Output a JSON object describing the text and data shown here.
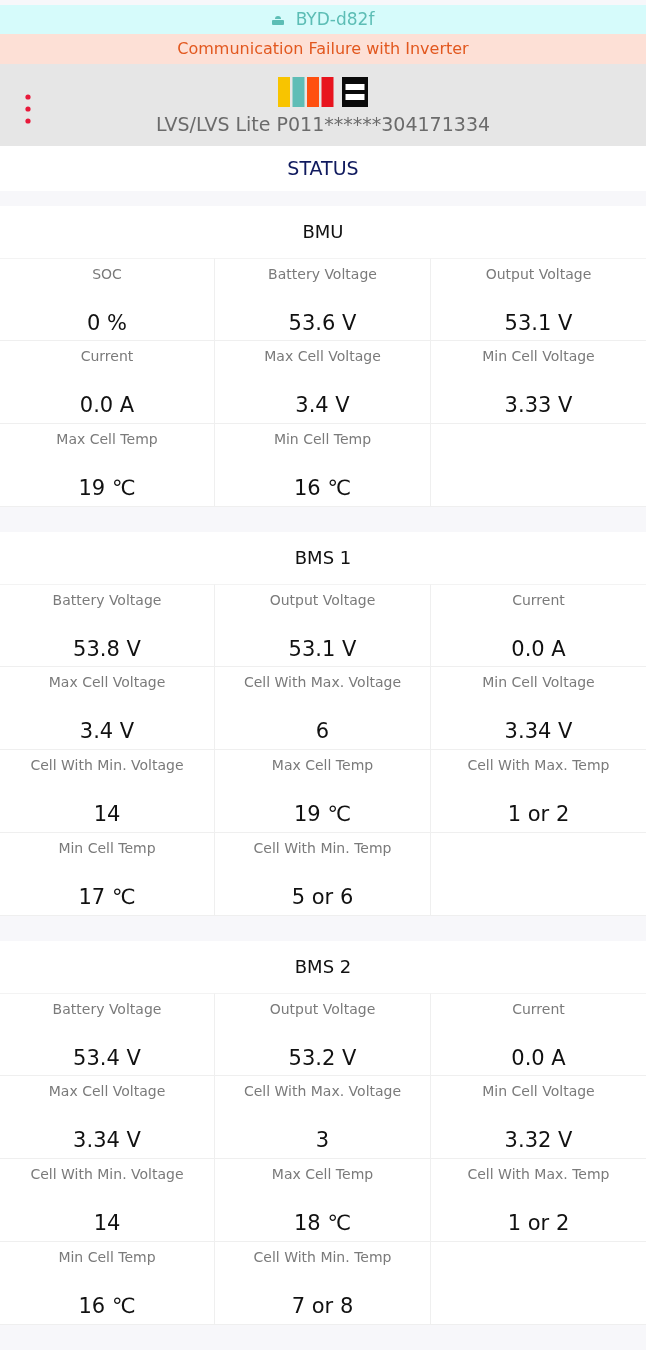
{
  "network": {
    "name": "BYD-d82f"
  },
  "alert": {
    "text": "Communication Failure with Inverter"
  },
  "header": {
    "device": "LVS/LVS Lite P011******304171334"
  },
  "page_title": "STATUS",
  "sections": [
    {
      "title": "BMU",
      "fields": [
        {
          "label": "SOC",
          "value": "0 %"
        },
        {
          "label": "Battery Voltage",
          "value": "53.6 V"
        },
        {
          "label": "Output Voltage",
          "value": "53.1 V"
        },
        {
          "label": "Current",
          "value": "0.0 A"
        },
        {
          "label": "Max Cell Voltage",
          "value": "3.4 V"
        },
        {
          "label": "Min Cell Voltage",
          "value": "3.33 V"
        },
        {
          "label": "Max Cell Temp",
          "value": "19 ℃"
        },
        {
          "label": "Min Cell Temp",
          "value": "16 ℃"
        }
      ]
    },
    {
      "title": "BMS 1",
      "fields": [
        {
          "label": "Battery Voltage",
          "value": "53.8 V"
        },
        {
          "label": "Output Voltage",
          "value": "53.1 V"
        },
        {
          "label": "Current",
          "value": "0.0 A"
        },
        {
          "label": "Max Cell Voltage",
          "value": "3.4 V"
        },
        {
          "label": "Cell With Max. Voltage",
          "value": "6"
        },
        {
          "label": "Min Cell Voltage",
          "value": "3.34 V"
        },
        {
          "label": "Cell With Min. Voltage",
          "value": "14"
        },
        {
          "label": "Max Cell Temp",
          "value": "19 ℃"
        },
        {
          "label": "Cell With Max. Temp",
          "value": "1 or 2"
        },
        {
          "label": "Min Cell Temp",
          "value": "17 ℃"
        },
        {
          "label": "Cell With Min. Temp",
          "value": "5 or 6"
        }
      ]
    },
    {
      "title": "BMS 2",
      "fields": [
        {
          "label": "Battery Voltage",
          "value": "53.4 V"
        },
        {
          "label": "Output Voltage",
          "value": "53.2 V"
        },
        {
          "label": "Current",
          "value": "0.0 A"
        },
        {
          "label": "Max Cell Voltage",
          "value": "3.34 V"
        },
        {
          "label": "Cell With Max. Voltage",
          "value": "3"
        },
        {
          "label": "Min Cell Voltage",
          "value": "3.32 V"
        },
        {
          "label": "Cell With Min. Voltage",
          "value": "14"
        },
        {
          "label": "Max Cell Temp",
          "value": "18 ℃"
        },
        {
          "label": "Cell With Max. Temp",
          "value": "1 or 2"
        },
        {
          "label": "Min Cell Temp",
          "value": "16 ℃"
        },
        {
          "label": "Cell With Min. Temp",
          "value": "7 or 8"
        }
      ]
    }
  ]
}
